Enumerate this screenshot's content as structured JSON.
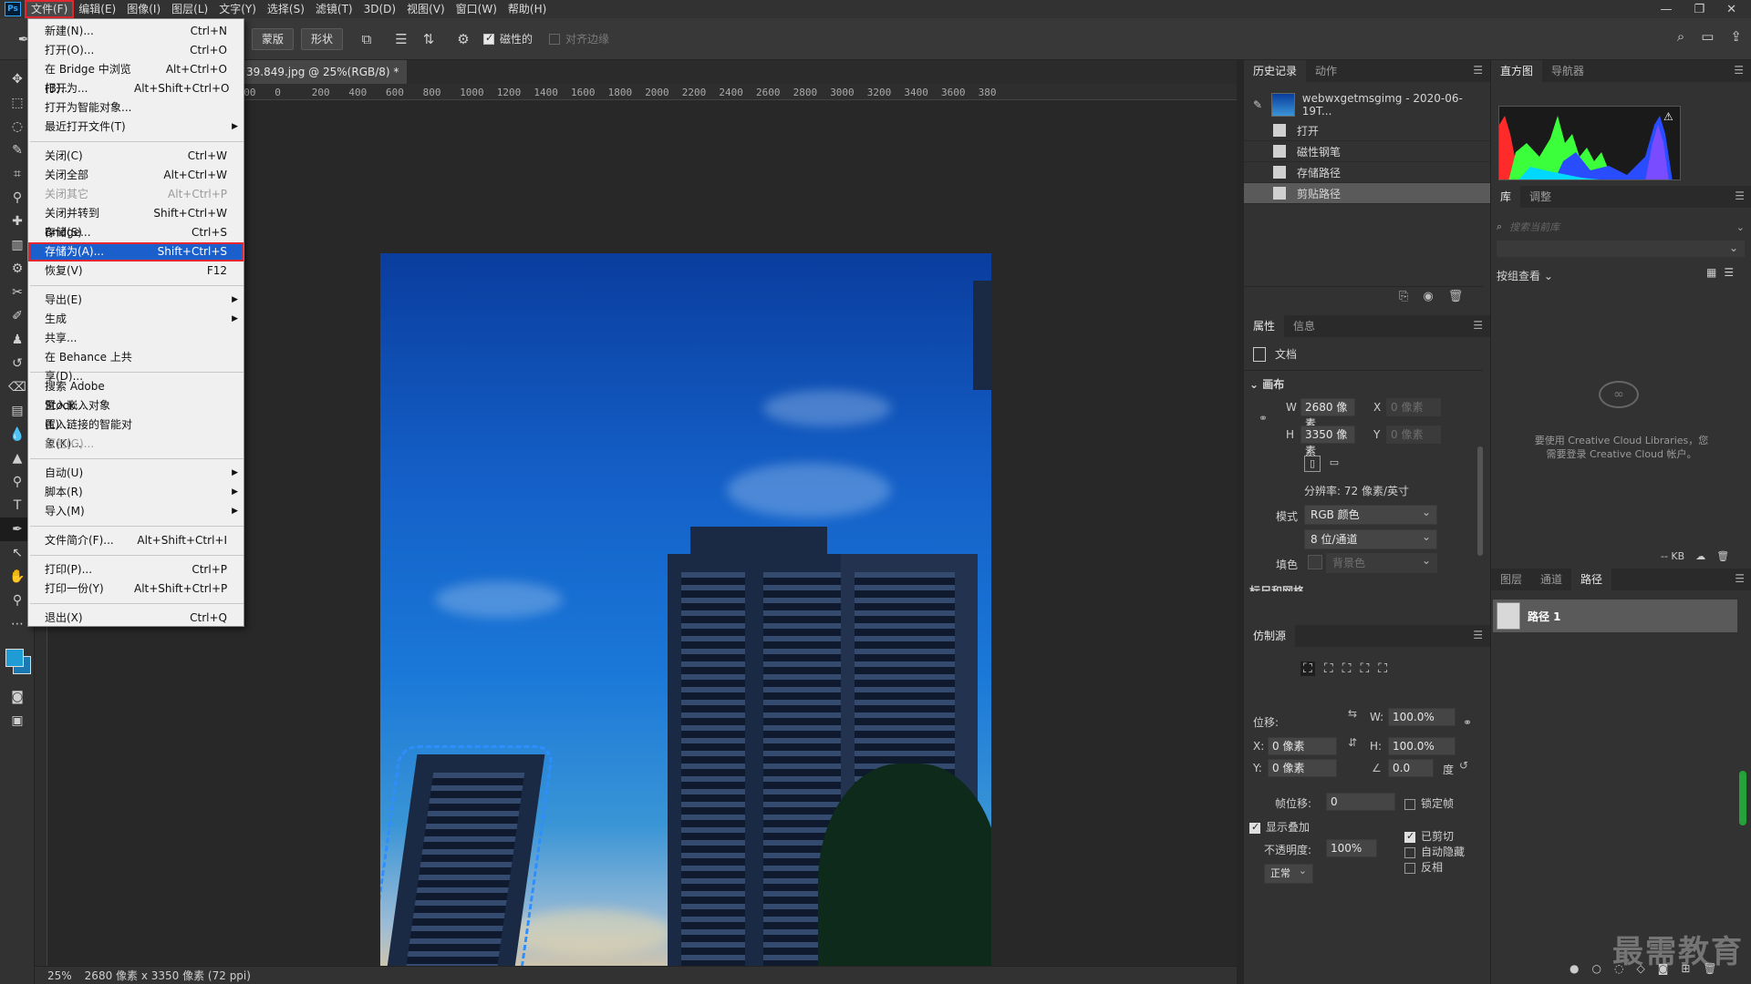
{
  "menubar": {
    "logo": "Ps",
    "items": [
      "文件(F)",
      "编辑(E)",
      "图像(I)",
      "图层(L)",
      "文字(Y)",
      "选择(S)",
      "滤镜(T)",
      "3D(D)",
      "视图(V)",
      "窗口(W)",
      "帮助(H)"
    ],
    "window_controls": [
      "—",
      "❐",
      "✕"
    ]
  },
  "options": {
    "mask_btn": "蒙版",
    "shape_btn": "形状",
    "magnetic_label": "磁性的",
    "align_edges_label": "对齐边缘"
  },
  "document": {
    "tab_title": "39.849.jpg @ 25%(RGB/8) *",
    "tab_close": "×",
    "ruler_ticks": [
      "400",
      "200",
      "0",
      "200",
      "400",
      "600",
      "800",
      "1000",
      "1200",
      "1400",
      "1600",
      "1800",
      "2000",
      "2200",
      "2400",
      "2600",
      "2800",
      "3000",
      "3200",
      "3400",
      "3600",
      "380"
    ],
    "zoom": "25%",
    "size_info": "2680 像素 x 3350 像素 (72 ppi)"
  },
  "file_menu": {
    "groups": [
      [
        {
          "label": "新建(N)...",
          "shortcut": "Ctrl+N"
        },
        {
          "label": "打开(O)...",
          "shortcut": "Ctrl+O"
        },
        {
          "label": "在 Bridge 中浏览(B)...",
          "shortcut": "Alt+Ctrl+O"
        },
        {
          "label": "打开为...",
          "shortcut": "Alt+Shift+Ctrl+O"
        },
        {
          "label": "打开为智能对象...",
          "shortcut": ""
        },
        {
          "label": "最近打开文件(T)",
          "shortcut": "",
          "submenu": true
        }
      ],
      [
        {
          "label": "关闭(C)",
          "shortcut": "Ctrl+W"
        },
        {
          "label": "关闭全部",
          "shortcut": "Alt+Ctrl+W"
        },
        {
          "label": "关闭其它",
          "shortcut": "Alt+Ctrl+P",
          "disabled": true
        },
        {
          "label": "关闭并转到 Bridge...",
          "shortcut": "Shift+Ctrl+W"
        },
        {
          "label": "存储(S)",
          "shortcut": "Ctrl+S"
        },
        {
          "label": "存储为(A)...",
          "shortcut": "Shift+Ctrl+S",
          "highlight": true
        },
        {
          "label": "恢复(V)",
          "shortcut": "F12"
        }
      ],
      [
        {
          "label": "导出(E)",
          "shortcut": "",
          "submenu": true
        },
        {
          "label": "生成",
          "shortcut": "",
          "submenu": true
        },
        {
          "label": "共享...",
          "shortcut": ""
        },
        {
          "label": "在 Behance 上共享(D)...",
          "shortcut": ""
        }
      ],
      [
        {
          "label": "搜索 Adobe Stock...",
          "shortcut": ""
        },
        {
          "label": "置入嵌入对象(L)...",
          "shortcut": ""
        },
        {
          "label": "置入链接的智能对象(K)...",
          "shortcut": ""
        },
        {
          "label": "打包(G)...",
          "shortcut": "",
          "disabled": true
        }
      ],
      [
        {
          "label": "自动(U)",
          "shortcut": "",
          "submenu": true
        },
        {
          "label": "脚本(R)",
          "shortcut": "",
          "submenu": true
        },
        {
          "label": "导入(M)",
          "shortcut": "",
          "submenu": true
        }
      ],
      [
        {
          "label": "文件简介(F)...",
          "shortcut": "Alt+Shift+Ctrl+I"
        }
      ],
      [
        {
          "label": "打印(P)...",
          "shortcut": "Ctrl+P"
        },
        {
          "label": "打印一份(Y)",
          "shortcut": "Alt+Shift+Ctrl+P"
        }
      ],
      [
        {
          "label": "退出(X)",
          "shortcut": "Ctrl+Q"
        }
      ]
    ]
  },
  "history_panel": {
    "tabs": [
      "历史记录",
      "动作"
    ],
    "snapshot": "webwxgetmsgimg - 2020-06-19T...",
    "steps": [
      "打开",
      "磁性钢笔",
      "存储路径",
      "剪贴路径"
    ]
  },
  "properties_panel": {
    "tabs": [
      "属性",
      "信息"
    ],
    "doc_label": "文档",
    "section": "画布",
    "w_label": "W",
    "w_value": "2680 像素",
    "h_label": "H",
    "h_value": "3350 像素",
    "x_label": "X",
    "x_value": "0 像素",
    "y_label": "Y",
    "y_value": "0 像素",
    "resolution": "分辨率: 72 像素/英寸",
    "mode_label": "模式",
    "mode_value": "RGB 颜色",
    "depth_value": "8 位/通道",
    "fill_label": "填色",
    "fill_value": "背景色",
    "next_section": "标尺和网格"
  },
  "clone_panel": {
    "tab": "仿制源",
    "offset_label": "位移:",
    "w_label": "W:",
    "w_value": "100.0%",
    "h_label": "H:",
    "h_value": "100.0%",
    "x_label": "X:",
    "x_value": "0 像素",
    "y_label": "Y:",
    "y_value": "0 像素",
    "angle_value": "0.0",
    "angle_unit": "度",
    "frame_offset_label": "帧位移:",
    "frame_offset_value": "0",
    "lock_frame": "锁定帧",
    "show_overlay": "显示叠加",
    "opacity_label": "不透明度:",
    "opacity_value": "100%",
    "clipped": "已剪切",
    "auto_hide": "自动隐藏",
    "invert": "反相",
    "blend_mode": "正常"
  },
  "histogram_panel": {
    "tabs": [
      "直方图",
      "导航器"
    ]
  },
  "library_panel": {
    "tabs": [
      "库",
      "调整"
    ],
    "search_placeholder": "搜索当前库",
    "view_by": "按组查看",
    "cc_msg_line1": "要使用 Creative Cloud Libraries，您",
    "cc_msg_line2": "需要登录 Creative Cloud 帐户。",
    "kb": "-- KB"
  },
  "paths_panel": {
    "tabs": [
      "图层",
      "通道",
      "路径"
    ],
    "path_name": "路径 1"
  },
  "watermark": "最需教育",
  "colors": {
    "accent_red": "#e3262f",
    "menu_highlight": "#1b5fcc",
    "selection_path": "#2e8eff"
  }
}
